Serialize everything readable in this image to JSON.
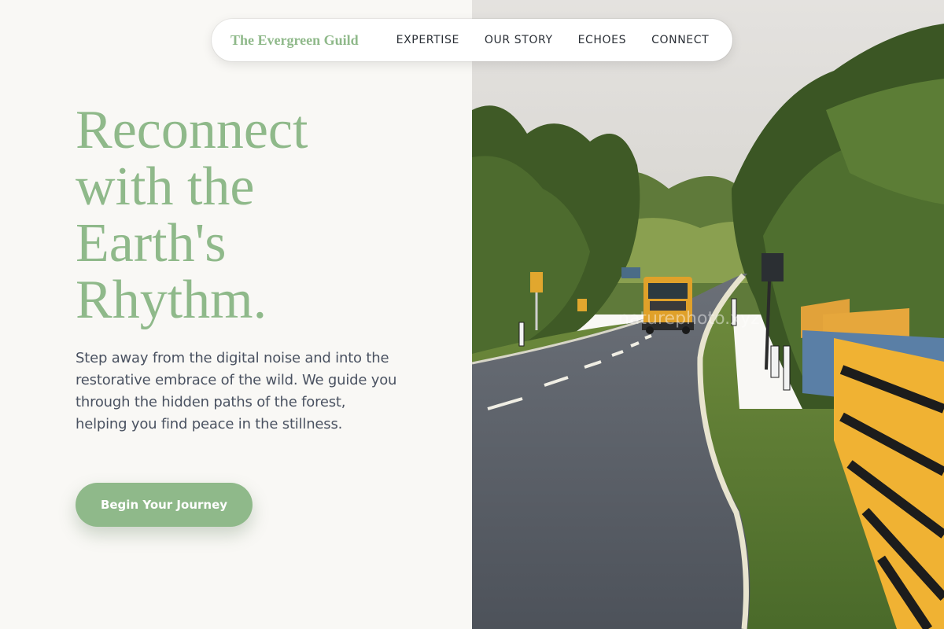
{
  "nav": {
    "brand": "The Evergreen Guild",
    "links": [
      {
        "label": "EXPERTISE"
      },
      {
        "label": "OUR STORY"
      },
      {
        "label": "ECHOES"
      },
      {
        "label": "CONNECT"
      }
    ]
  },
  "hero": {
    "title_lines": [
      "Reconnect",
      "with the",
      "Earth's",
      "Rhythm."
    ],
    "description": "Step away from the digital noise and into the restorative embrace of the wild. We guide you through the hidden paths of the forest, helping you find peace in the stillness.",
    "cta_label": "Begin Your Journey"
  },
  "image": {
    "watermark": "naturephoto.xyz"
  },
  "colors": {
    "accent": "#8fb98a",
    "background": "#f9f8f5",
    "body_text": "#4a5261",
    "nav_text": "#2a2f36"
  }
}
